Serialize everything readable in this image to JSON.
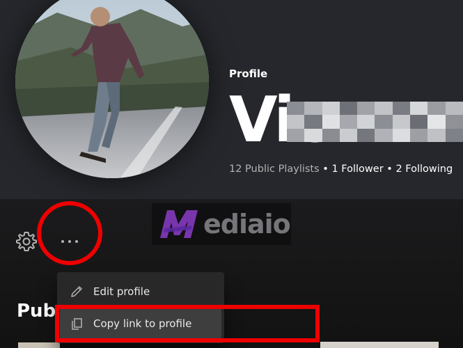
{
  "header": {
    "type_label": "Profile",
    "name_visible": "Vic",
    "stats_playlists": "12 Public Playlists",
    "stats_followers": "1 Follower",
    "stats_following": "2 Following",
    "separator": " • "
  },
  "watermark": {
    "text": "ediaio"
  },
  "sections": {
    "public_playlists_title_visible": "Publ"
  },
  "context_menu": {
    "items": [
      {
        "label": "Edit profile",
        "icon": "pencil-icon"
      },
      {
        "label": "Copy link to profile",
        "icon": "copy-icon"
      }
    ]
  },
  "icons": {
    "settings": "gear-icon",
    "more": "more-options-icon"
  },
  "colors": {
    "header_bg": "#25272c",
    "page_bg": "#121212",
    "menu_bg": "#282828",
    "menu_hover": "#3e3e3e",
    "highlight_red": "#ee0000"
  }
}
